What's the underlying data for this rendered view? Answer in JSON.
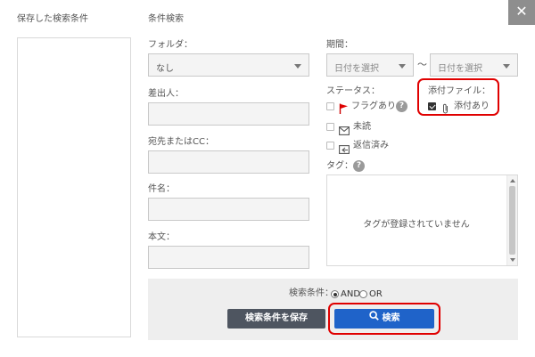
{
  "close_label": "✕",
  "saved": {
    "title": "保存した検索条件"
  },
  "search": {
    "title": "条件検索",
    "folder": {
      "label": "フォルダ：",
      "value": "なし"
    },
    "sender": {
      "label": "差出人：",
      "value": ""
    },
    "recipient": {
      "label": "宛先またはCC：",
      "value": ""
    },
    "subject": {
      "label": "件名：",
      "value": ""
    },
    "body": {
      "label": "本文：",
      "value": ""
    },
    "period": {
      "label": "期間：",
      "from_placeholder": "日付を選択",
      "to_placeholder": "日付を選択",
      "separator": "〜"
    },
    "status": {
      "label": "ステータス：",
      "options": [
        {
          "label": "フラグあり",
          "checked": false,
          "icon": "flag-icon"
        },
        {
          "label": "未読",
          "checked": false,
          "icon": "envelope-icon"
        },
        {
          "label": "返信済み",
          "checked": false,
          "icon": "reply-icon"
        }
      ],
      "help": "?"
    },
    "attachment": {
      "label": "添付ファイル：",
      "option_label": "添付あり",
      "checked": true,
      "icon": "paperclip-icon"
    },
    "tags": {
      "label": "タグ：",
      "help": "?",
      "empty_message": "タグが登録されていません"
    },
    "condition": {
      "label": "検索条件：",
      "and": "AND",
      "or": "OR",
      "selected": "AND"
    },
    "save_button": "検索条件を保存",
    "search_button": "検索"
  },
  "colors": {
    "accent": "#1f63c9",
    "highlight": "#e00000",
    "flag": "#e00000",
    "save_button": "#4e5560"
  }
}
